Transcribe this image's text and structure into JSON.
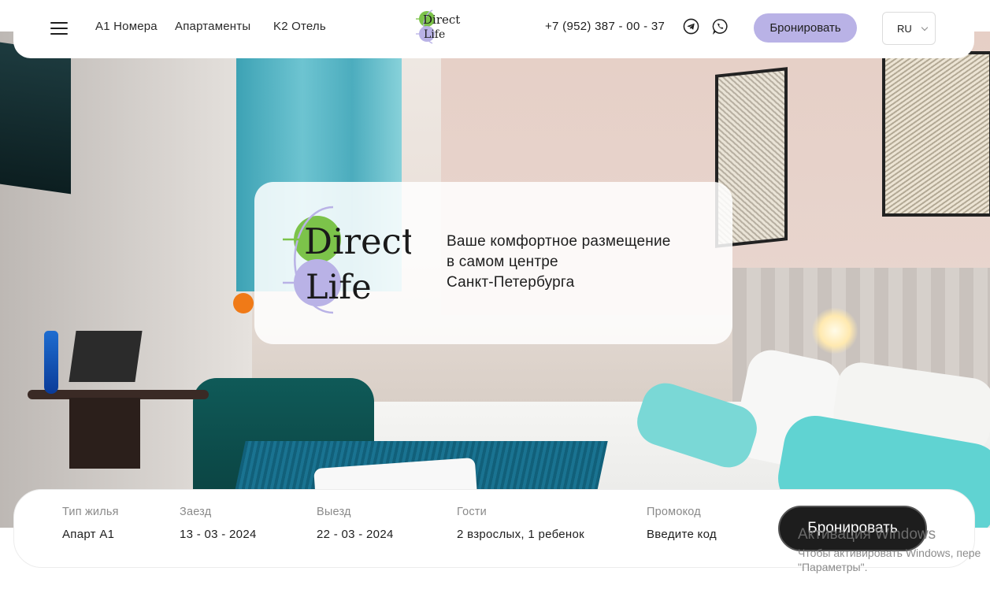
{
  "header": {
    "nav": [
      "A1 Номера",
      "Апартаменты",
      "K2 Отель"
    ],
    "logo": {
      "line1": "Direct",
      "line2": "Life"
    },
    "phone": "+7 (952) 387 - 00 - 37",
    "book_label": "Бронировать",
    "language": "RU",
    "colors": {
      "accent": "#b9b2e6",
      "logo_green": "#7cc34a"
    }
  },
  "hero": {
    "logo": {
      "line1": "Direct",
      "line2": "Life"
    },
    "tagline": [
      "Ваше комфортное размещение",
      "в самом центре",
      "Санкт-Петербурга"
    ]
  },
  "booking": {
    "fields": [
      {
        "label": "Тип жилья",
        "value": "Апарт А1"
      },
      {
        "label": "Заезд",
        "value": "13 - 03 - 2024"
      },
      {
        "label": "Выезд",
        "value": "22 - 03 - 2024"
      },
      {
        "label": "Гости",
        "value": "2 взрослых, 1 ребенок"
      },
      {
        "label": "Промокод",
        "value": "Введите код"
      }
    ],
    "book_label": "Бронировать"
  },
  "watermark": {
    "title": "Активация Windows",
    "line1": "Чтобы активировать Windows, пере",
    "line2": "\"Параметры\"."
  }
}
